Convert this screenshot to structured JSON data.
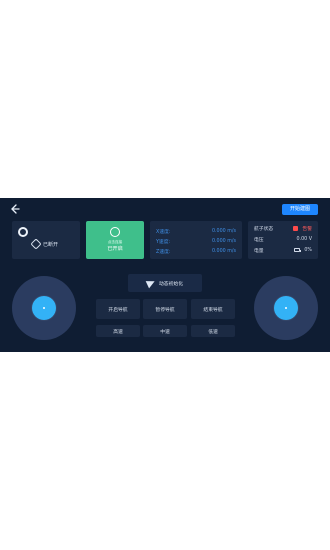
{
  "header": {
    "back_icon": "back-arrow-icon",
    "start_mapping_label": "开始建图"
  },
  "connection": {
    "status_text": "已断开",
    "avatar_icon": "robot-avatar-icon",
    "link_icon": "link-icon"
  },
  "power": {
    "caption": "点击连接",
    "status": "已开启",
    "icon": "power-icon"
  },
  "speed": {
    "x_label": "X速度:",
    "x_value": "0.000 m/s",
    "y_label": "Y速度:",
    "y_value": "0.000 m/s",
    "z_label": "Z速度:",
    "z_value": "0.000 m/s"
  },
  "status": {
    "dog_status_label": "航子状态",
    "dog_status_value": "告警",
    "voltage_label": "电压",
    "voltage_value": "0.00 V",
    "battery_label": "电量",
    "battery_value": "0%"
  },
  "controls": {
    "dynamic_init": "动态初始化",
    "send_icon": "send-icon",
    "left_joystick_icon": "joystick-left-icon",
    "right_joystick_icon": "joystick-right-icon"
  },
  "navigation": {
    "start": "开启导航",
    "pause": "暂停导航",
    "end": "结束导航"
  },
  "speed_modes": {
    "high": "高速",
    "medium": "中速",
    "low": "低速"
  },
  "colors": {
    "background": "#0f1d33",
    "panel": "#1b2a43",
    "accent_blue": "#1e86ff",
    "power_green": "#3fbf8b",
    "joystick_blue": "#33b2f6",
    "alarm_red": "#ff4b4b"
  }
}
